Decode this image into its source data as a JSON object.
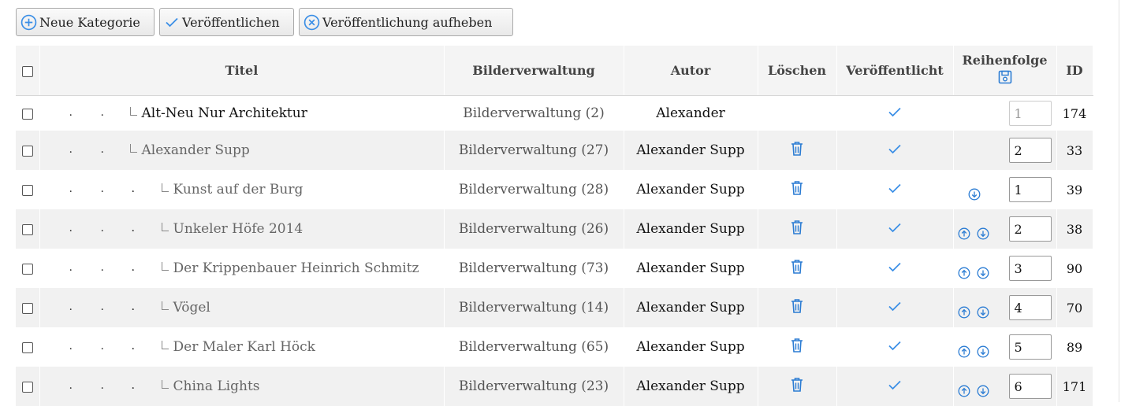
{
  "toolbar": {
    "new_category": "Neue Kategorie",
    "publish": "Veröffentlichen",
    "unpublish": "Veröffentlichung aufheben"
  },
  "columns": {
    "title": "Titel",
    "images": "Bilderverwaltung",
    "author": "Autor",
    "delete": "Löschen",
    "published": "Veröffentlicht",
    "order": "Reihenfolge",
    "id": "ID"
  },
  "colors": {
    "accent": "#3a8ee6",
    "icon_blue": "#2b7cd3"
  },
  "rows": [
    {
      "level": 2,
      "title": "Alt-Neu Nur Architektur",
      "images": "Bilderverwaltung (2)",
      "author": "Alexander",
      "deletable": false,
      "published": true,
      "up": false,
      "down": false,
      "order": "1",
      "order_disabled": true,
      "id": "174"
    },
    {
      "level": 2,
      "title": "Alexander Supp",
      "images": "Bilderverwaltung (27)",
      "author": "Alexander Supp",
      "deletable": true,
      "published": true,
      "up": false,
      "down": false,
      "order": "2",
      "order_disabled": false,
      "id": "33"
    },
    {
      "level": 3,
      "title": "Kunst auf der Burg",
      "images": "Bilderverwaltung (28)",
      "author": "Alexander Supp",
      "deletable": true,
      "published": true,
      "up": false,
      "down": true,
      "order": "1",
      "order_disabled": false,
      "id": "39"
    },
    {
      "level": 3,
      "title": "Unkeler Höfe 2014",
      "images": "Bilderverwaltung (26)",
      "author": "Alexander Supp",
      "deletable": true,
      "published": true,
      "up": true,
      "down": true,
      "order": "2",
      "order_disabled": false,
      "id": "38"
    },
    {
      "level": 3,
      "title": "Der Krippenbauer Heinrich Schmitz",
      "images": "Bilderverwaltung (73)",
      "author": "Alexander Supp",
      "deletable": true,
      "published": true,
      "up": true,
      "down": true,
      "order": "3",
      "order_disabled": false,
      "id": "90"
    },
    {
      "level": 3,
      "title": "Vögel",
      "images": "Bilderverwaltung (14)",
      "author": "Alexander Supp",
      "deletable": true,
      "published": true,
      "up": true,
      "down": true,
      "order": "4",
      "order_disabled": false,
      "id": "70"
    },
    {
      "level": 3,
      "title": "Der Maler Karl Höck",
      "images": "Bilderverwaltung (65)",
      "author": "Alexander Supp",
      "deletable": true,
      "published": true,
      "up": true,
      "down": true,
      "order": "5",
      "order_disabled": false,
      "id": "89"
    },
    {
      "level": 3,
      "title": "China Lights",
      "images": "Bilderverwaltung (23)",
      "author": "Alexander Supp",
      "deletable": true,
      "published": true,
      "up": true,
      "down": true,
      "order": "6",
      "order_disabled": false,
      "id": "171"
    }
  ]
}
